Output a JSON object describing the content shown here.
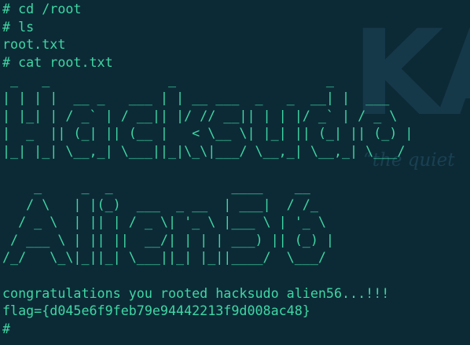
{
  "background": {
    "color": "#0c2a36",
    "logo_text": "KA",
    "tagline": "“the quiet"
  },
  "colors": {
    "terminal_text": "#3fd7a4",
    "watermark": "#16394a"
  },
  "terminal": {
    "lines_before": [
      "# cd /root",
      "# ls",
      "root.txt",
      "# cat root.txt"
    ],
    "banner_hacksudo": " _   _               _                   _       \n| | | |  __ _   ___ | | __ ___  _   _  __| |  ___  \n| |_| | / _` | / __|| |/ // __|| | | |/ _` | / _ \\ \n|  _  || (_| || (__ |   < \\__ \\| |_| || (_| || (_) |\n|_| |_| \\__,_| \\___||_|\\_\\|___/ \\__,_| \\__,_| \\___/ ",
    "banner_alien56": "    _     _  _               ____    __  \n   / \\   | |(_)  ___  _ __  | ___|  / /_ \n  / _ \\  | || | / _ \\| '_ \\ |___ \\ | '_ \\\n / ___ \\ | || ||  __/| | | | ___) || (_) |\n/_/   \\_\\|_||_| \\___||_| |_||____/  \\___/ ",
    "congrats": "congratulations you rooted hacksudo alien56...!!!",
    "flag": "flag={d045e6f9feb79e94442213f9d008ac48}",
    "prompt": "#"
  }
}
